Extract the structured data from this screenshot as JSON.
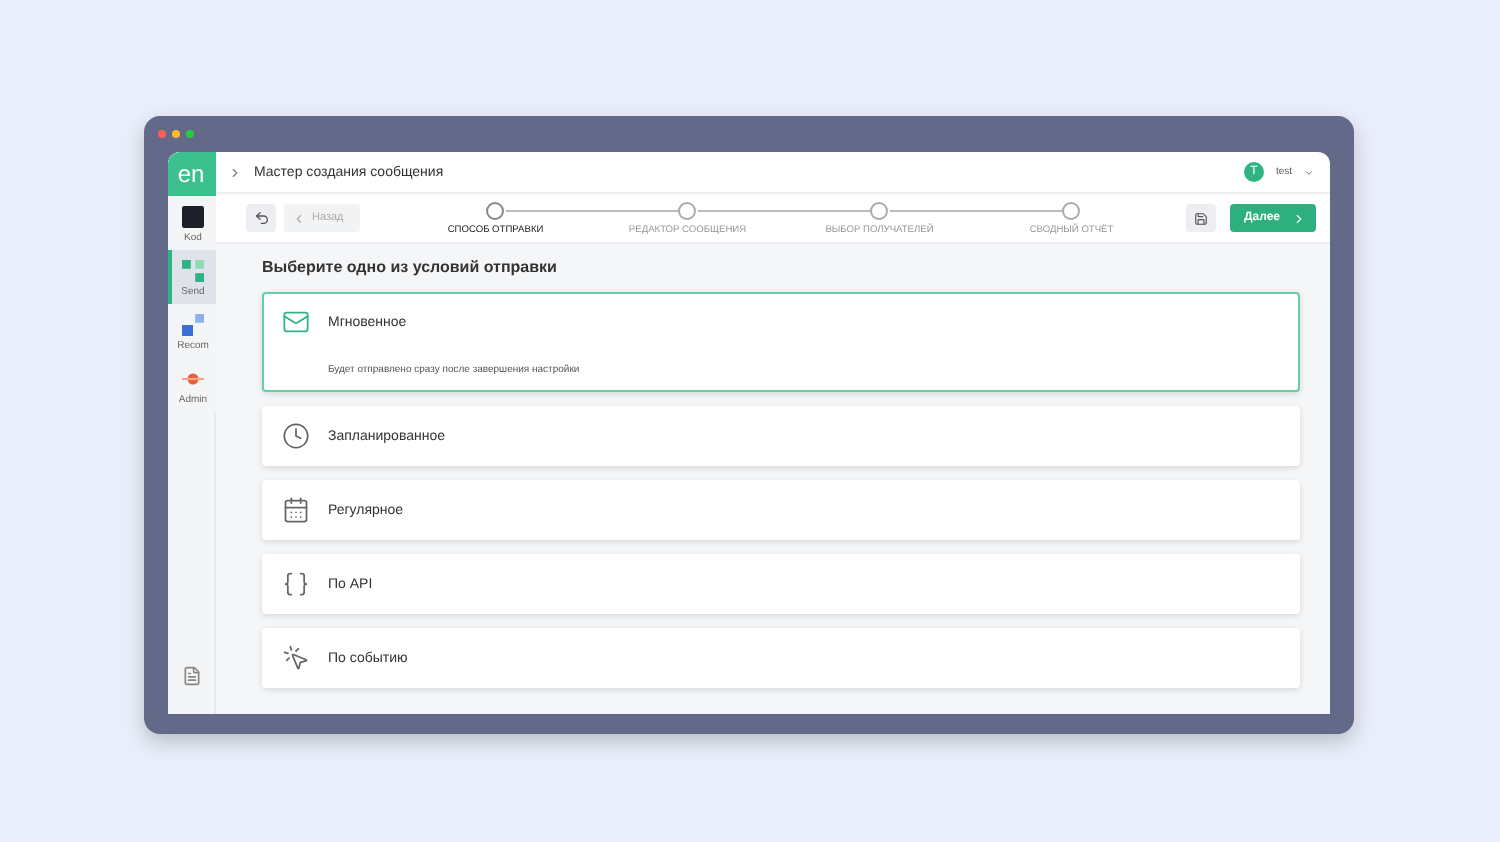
{
  "logo": "en",
  "sidebar": {
    "items": [
      {
        "label": "Kod",
        "kind": "dark",
        "selected": false
      },
      {
        "label": "Send",
        "kind": "send",
        "selected": true
      },
      {
        "label": "Recom",
        "kind": "recom",
        "selected": false
      },
      {
        "label": "Admin",
        "kind": "admin",
        "selected": false
      }
    ]
  },
  "header": {
    "title": "Мастер создания сообщения",
    "user": {
      "initial": "T",
      "name": "test"
    }
  },
  "toolbar": {
    "back": {
      "label": "Назад",
      "disabled": true
    },
    "next": {
      "label": "Далее"
    }
  },
  "steps": [
    {
      "label": "СПОСОБ ОТПРАВКИ",
      "selected": true
    },
    {
      "label": "РЕДАКТОР СООБЩЕНИЯ",
      "selected": false
    },
    {
      "label": "ВЫБОР ПОЛУЧАТЕЛЕЙ",
      "selected": false
    },
    {
      "label": "СВОДНЫЙ ОТЧЁТ",
      "selected": false
    }
  ],
  "heading": "Выберите одно из условий отправки",
  "options": [
    {
      "kind": "instant",
      "label": "Мгновенное",
      "selected": true,
      "description": "Будет отправлено сразу после завершения настройки"
    },
    {
      "kind": "scheduled",
      "label": "Запланированное",
      "selected": false
    },
    {
      "kind": "regular",
      "label": "Регулярное",
      "selected": false
    },
    {
      "kind": "api",
      "label": "По API",
      "selected": false
    },
    {
      "kind": "event",
      "label": "По событию",
      "selected": false
    }
  ]
}
